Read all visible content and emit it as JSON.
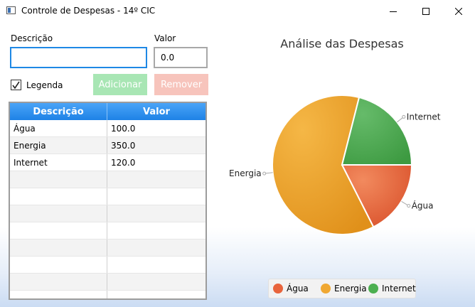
{
  "window": {
    "title": "Controle de Despesas - 14º CIC"
  },
  "form": {
    "descricao_label": "Descrição",
    "descricao_value": "",
    "valor_label": "Valor",
    "valor_value": "0.0",
    "legenda_label": "Legenda",
    "legenda_checked": true,
    "add_label": "Adicionar",
    "remove_label": "Remover"
  },
  "table": {
    "columns": [
      "Descrição",
      "Valor"
    ],
    "rows": [
      [
        "Água",
        "100.0"
      ],
      [
        "Energia",
        "350.0"
      ],
      [
        "Internet",
        "120.0"
      ]
    ]
  },
  "colors": {
    "agua": "#e8643c",
    "energia": "#f0a832",
    "internet": "#4caf50",
    "header": "#1e82e6",
    "add_button": "#a8e6b4",
    "remove_button": "#f7c4bc",
    "input_focus": "#1e88e5"
  },
  "chart_data": {
    "type": "pie",
    "title": "Análise das Despesas",
    "categories": [
      "Água",
      "Energia",
      "Internet"
    ],
    "values": [
      100.0,
      350.0,
      120.0
    ],
    "legend": "bottom",
    "slice_labels": [
      "Água",
      "Energia",
      "Internet"
    ]
  }
}
